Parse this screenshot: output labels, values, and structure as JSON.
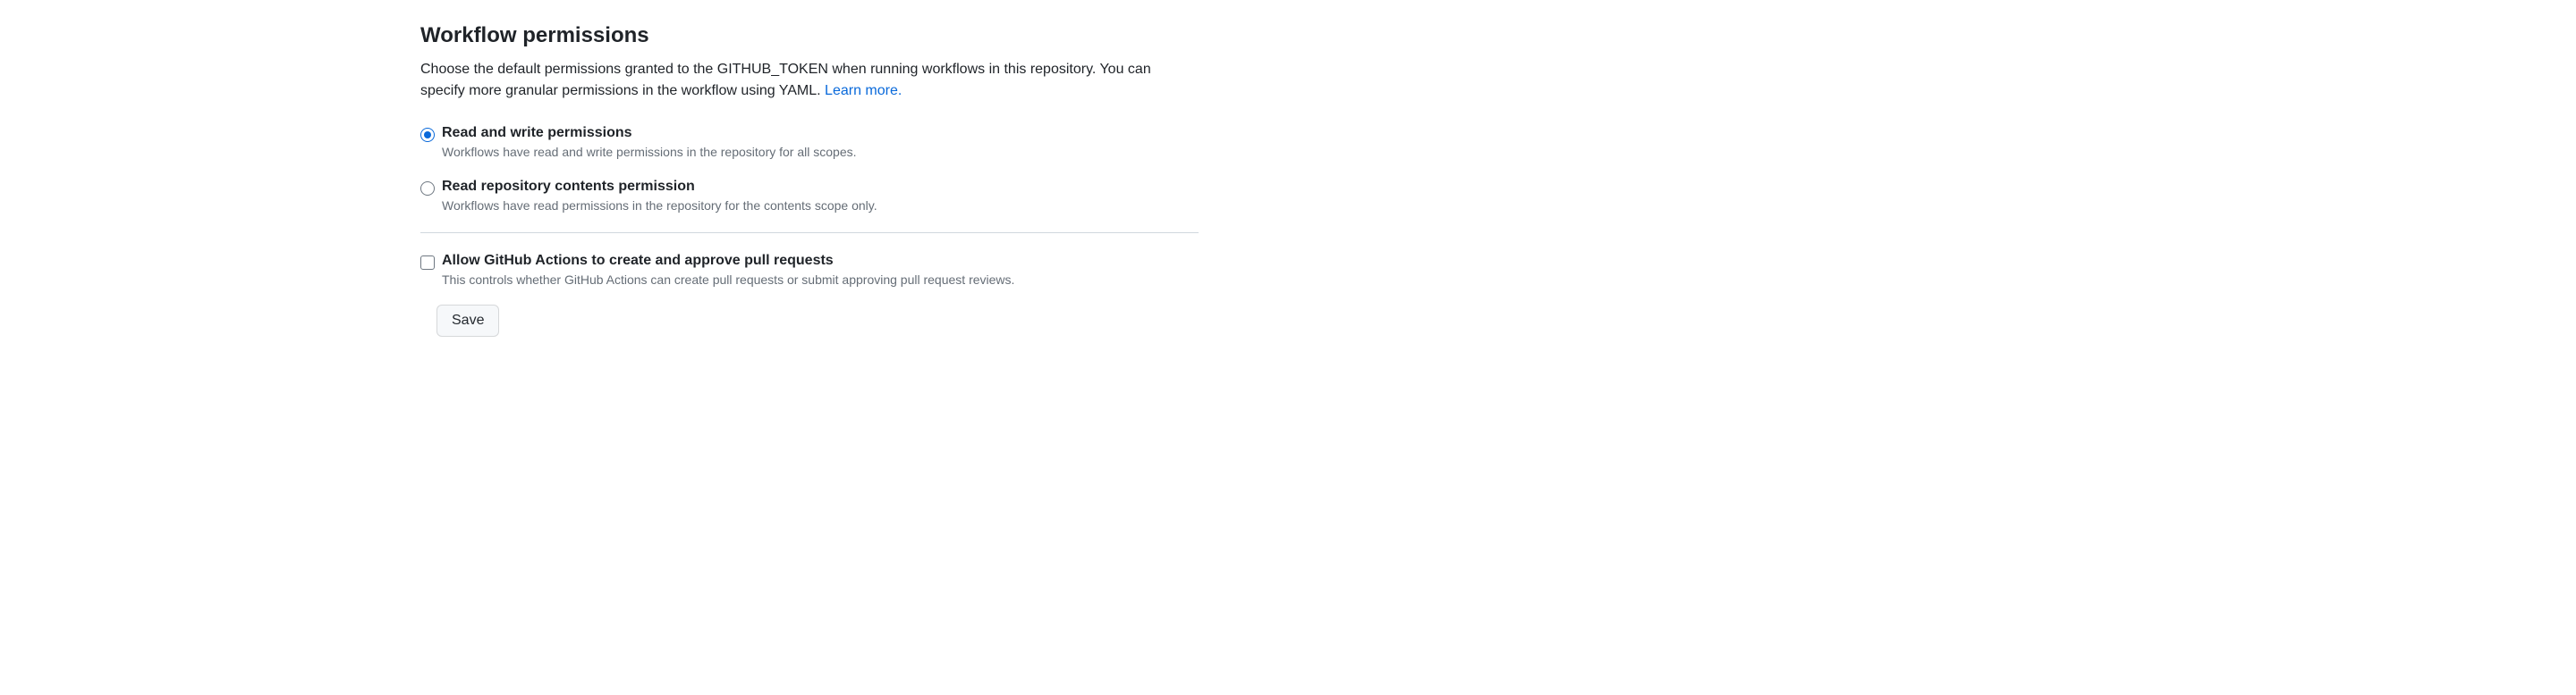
{
  "section": {
    "title": "Workflow permissions",
    "description_main": "Choose the default permissions granted to the GITHUB_TOKEN when running workflows in this repository. You can specify more granular permissions in the workflow using YAML. ",
    "learn_more": "Learn more."
  },
  "permissions": {
    "options": [
      {
        "label": "Read and write permissions",
        "sub": "Workflows have read and write permissions in the repository for all scopes.",
        "selected": true
      },
      {
        "label": "Read repository contents permission",
        "sub": "Workflows have read permissions in the repository for the contents scope only.",
        "selected": false
      }
    ]
  },
  "pr_checkbox": {
    "label": "Allow GitHub Actions to create and approve pull requests",
    "sub": "This controls whether GitHub Actions can create pull requests or submit approving pull request reviews.",
    "checked": false
  },
  "save_button": {
    "label": "Save"
  }
}
